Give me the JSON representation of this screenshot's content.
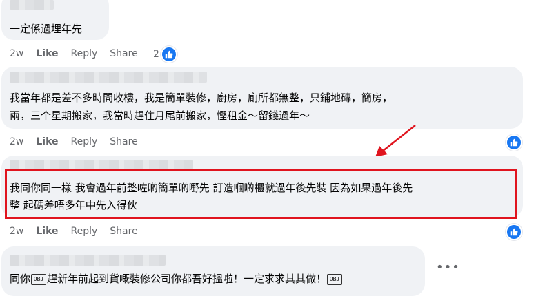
{
  "comments": [
    {
      "text_lines": [
        "一定係過埋年先"
      ],
      "time": "2w",
      "like_label": "Like",
      "reply_label": "Reply",
      "share_label": "Share",
      "reaction_count": "2"
    },
    {
      "text_lines": [
        "我當年都是差不多時間收樓，我是簡單裝修，廚房，廁所都無整，只鋪地磚，簡房，",
        "兩，三个星期搬家，我當時趕住月尾前搬家，慳租金～留錢過年～"
      ],
      "time": "2w",
      "like_label": "Like",
      "reply_label": "Reply",
      "share_label": "Share"
    },
    {
      "text_lines": [
        "我同你同一樣 我會過年前整咗啲簡單啲嘢先 訂造嗰啲櫃就過年後先裝 因為如果過年後先",
        "整 起碼差唔多年中先入得伙"
      ],
      "time": "2w",
      "like_label": "Like",
      "reply_label": "Reply",
      "share_label": "Share"
    },
    {
      "text_parts": [
        "同你",
        "趕新年前起到貨嘅裝修公司你都吾好搵啦！一定求求其其做！"
      ],
      "emoji_label": "OBJ"
    }
  ],
  "colors": {
    "bubble": "#f0f2f5",
    "meta": "#65676b",
    "like_blue": "#1877f2",
    "highlight_red": "#e0141e"
  }
}
